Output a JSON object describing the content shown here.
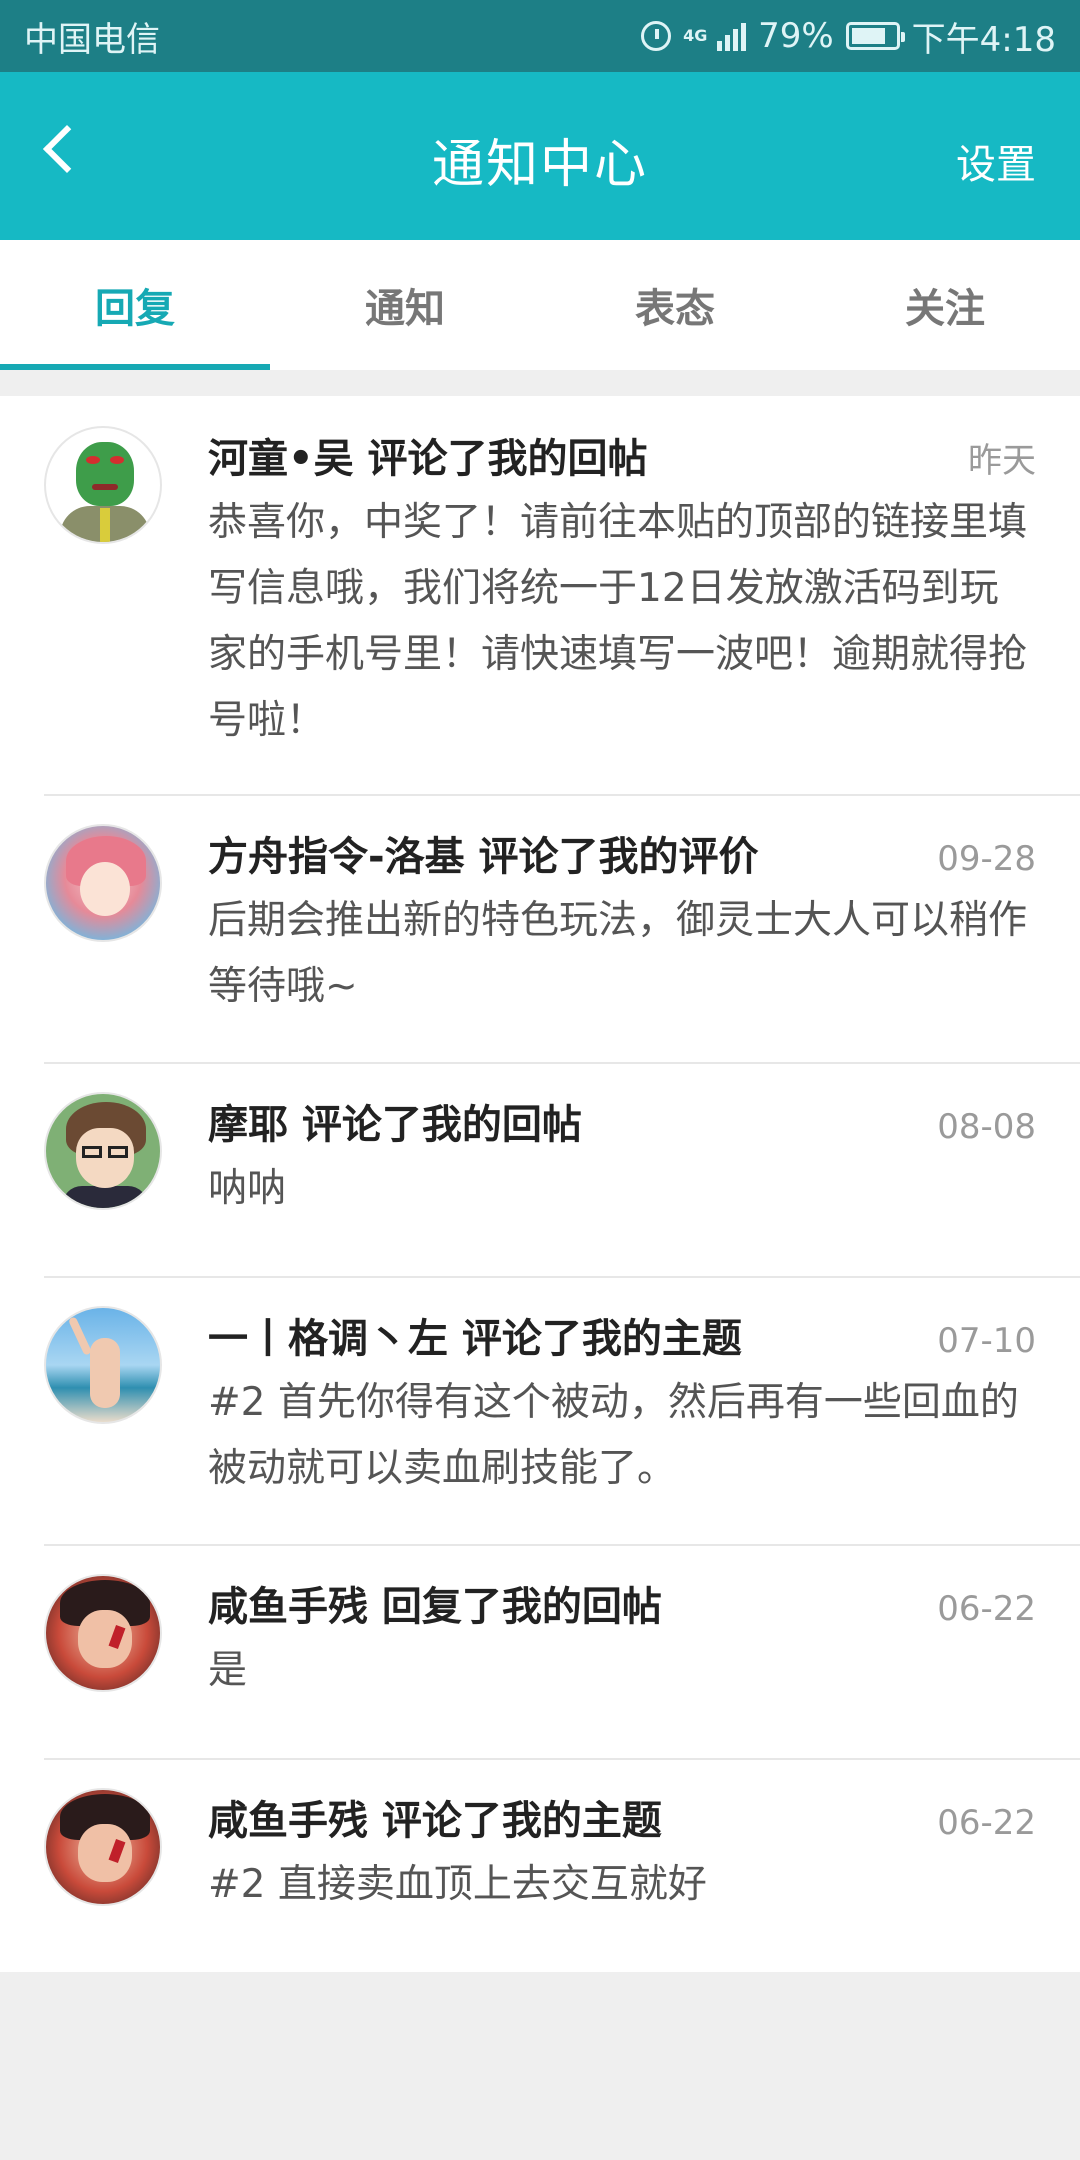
{
  "status_bar": {
    "carrier": "中国电信",
    "network": "4G",
    "battery_percent": "79%",
    "battery_level": 0.79,
    "time": "下午4:18"
  },
  "header": {
    "title": "通知中心",
    "settings_label": "设置"
  },
  "tabs": [
    {
      "label": "回复",
      "active": true
    },
    {
      "label": "通知",
      "active": false
    },
    {
      "label": "表态",
      "active": false
    },
    {
      "label": "关注",
      "active": false
    }
  ],
  "items": [
    {
      "title": "河童•吴 评论了我的回帖",
      "time": "昨天",
      "body": "恭喜你，中奖了！请前往本贴的顶部的链接里填写信息哦，我们将统一于12日发放激活码到玩家的手机号里！请快速填写一波吧！逾期就得抢号啦！"
    },
    {
      "title": "方舟指令-洛基 评论了我的评价",
      "time": "09-28",
      "body": "后期会推出新的特色玩法，御灵士大人可以稍作等待哦~"
    },
    {
      "title": "摩耶 评论了我的回帖",
      "time": "08-08",
      "body": "呐呐"
    },
    {
      "title": "一丨格调丶左 评论了我的主题",
      "time": "07-10",
      "body": "#2 首先你得有这个被动，然后再有一些回血的被动就可以卖血刷技能了。"
    },
    {
      "title": "咸鱼手残 回复了我的回帖",
      "time": "06-22",
      "body": "是"
    },
    {
      "title": "咸鱼手残 评论了我的主题",
      "time": "06-22",
      "body": "#2 直接卖血顶上去交互就好"
    }
  ]
}
